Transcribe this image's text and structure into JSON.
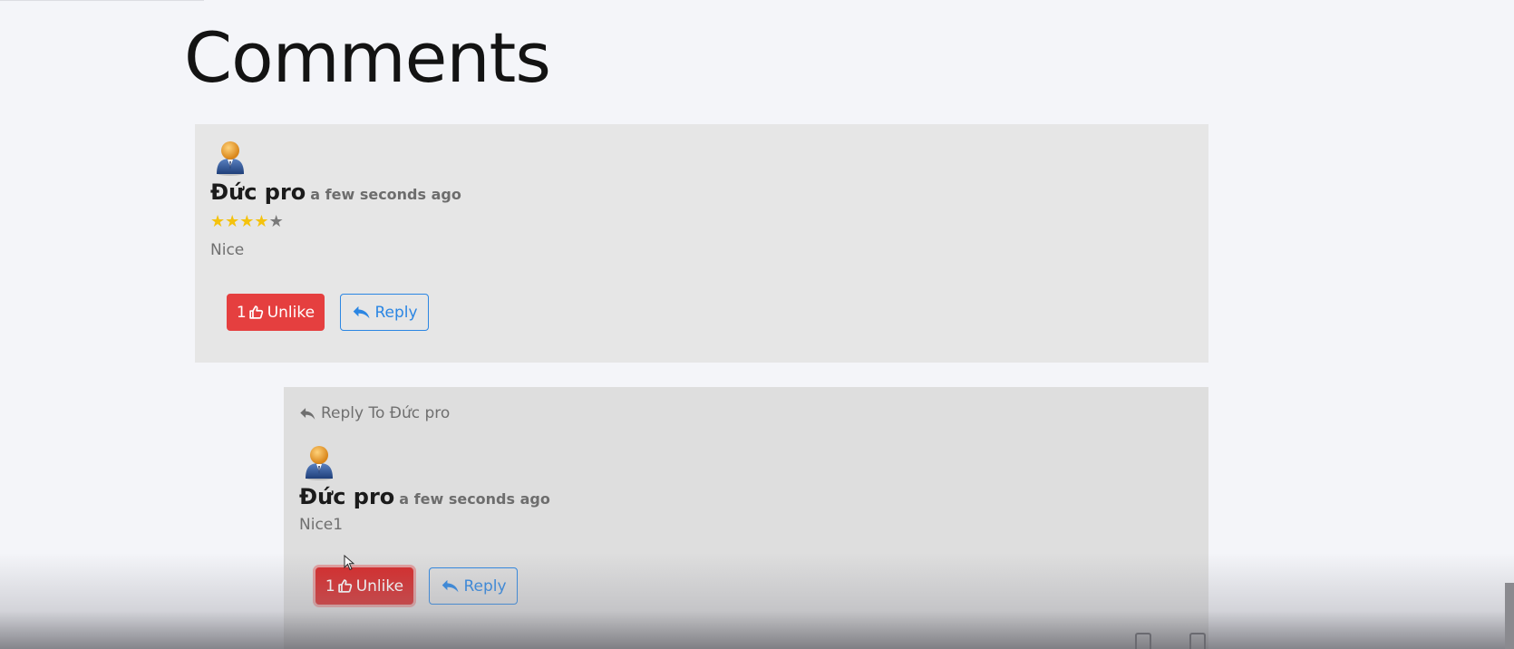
{
  "page": {
    "title": "Comments"
  },
  "comments": [
    {
      "author": "Đức pro",
      "time": "a few seconds ago",
      "rating": 4,
      "rating_max": 5,
      "text": "Nice",
      "likes": "1",
      "unlike_label": "Unlike",
      "reply_label": "Reply"
    }
  ],
  "replies": [
    {
      "reply_to_label": "Reply To Đức pro",
      "author": "Đức pro",
      "time": "a few seconds ago",
      "text": "Nice1",
      "likes": "1",
      "unlike_label": "Unlike",
      "reply_label": "Reply"
    }
  ],
  "colors": {
    "unlike_button": "#e53f3f",
    "reply_button": "#2b86e3",
    "star_filled": "#f4c20d",
    "star_empty": "#7a7a7a",
    "card_background": "#e6e6e6"
  },
  "icons": {
    "avatar": "user-avatar-icon",
    "like": "thumbs-up-icon",
    "reply": "reply-icon"
  }
}
